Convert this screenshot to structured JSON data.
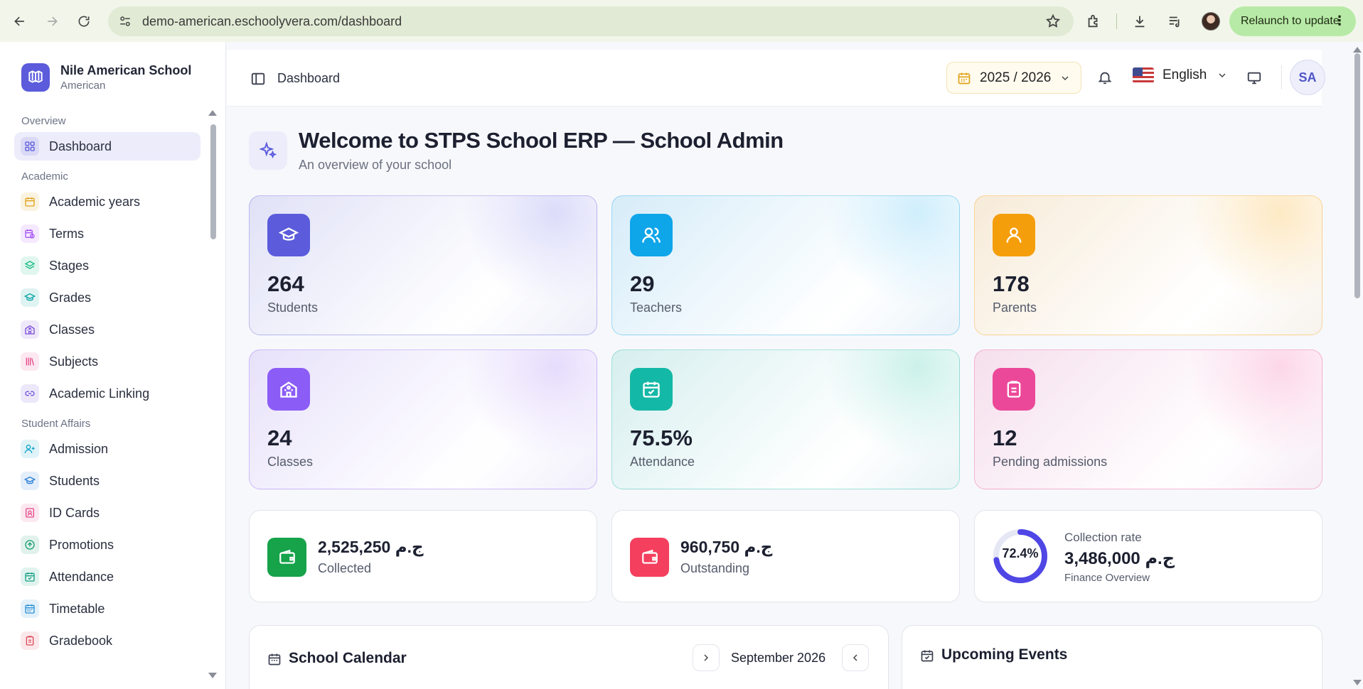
{
  "browser": {
    "url": "demo-american.eschoolyvera.com/dashboard",
    "relaunch_label": "Relaunch to update"
  },
  "school": {
    "name": "Nile American School",
    "type": "American"
  },
  "sidebar": {
    "sections": [
      {
        "label": "Overview",
        "items": [
          {
            "label": "Dashboard",
            "icon": "grid-icon",
            "color": "#5b5bdc",
            "active": true
          }
        ]
      },
      {
        "label": "Academic",
        "items": [
          {
            "label": "Academic years",
            "icon": "calendar-icon",
            "color": "#e0a21a"
          },
          {
            "label": "Terms",
            "icon": "calendar-clock-icon",
            "color": "#a855f7"
          },
          {
            "label": "Stages",
            "icon": "layers-icon",
            "color": "#10b981"
          },
          {
            "label": "Grades",
            "icon": "graduation-cap-icon",
            "color": "#0ea5a5"
          },
          {
            "label": "Classes",
            "icon": "school-icon",
            "color": "#7c4dd8"
          },
          {
            "label": "Subjects",
            "icon": "library-icon",
            "color": "#e64a8a"
          },
          {
            "label": "Academic Linking",
            "icon": "link-icon",
            "color": "#6d4fd8"
          }
        ]
      },
      {
        "label": "Student Affairs",
        "items": [
          {
            "label": "Admission",
            "icon": "user-plus-icon",
            "color": "#0ea5c9"
          },
          {
            "label": "Students",
            "icon": "graduation-cap-icon",
            "color": "#2a7fd8"
          },
          {
            "label": "ID Cards",
            "icon": "id-card-icon",
            "color": "#e64a8a"
          },
          {
            "label": "Promotions",
            "icon": "arrow-up-circle-icon",
            "color": "#1a9e70"
          },
          {
            "label": "Attendance",
            "icon": "calendar-check-icon",
            "color": "#14a085"
          },
          {
            "label": "Timetable",
            "icon": "calendar-grid-icon",
            "color": "#2a8fd8"
          },
          {
            "label": "Gradebook",
            "icon": "clipboard-icon",
            "color": "#e04a5a"
          }
        ]
      }
    ]
  },
  "topbar": {
    "breadcrumb": "Dashboard",
    "academic_year": "2025 / 2026",
    "language": "English",
    "avatar_initials": "SA"
  },
  "welcome": {
    "title": "Welcome to STPS School ERP — School Admin",
    "subtitle": "An overview of your school"
  },
  "stats": [
    {
      "value": "264",
      "label": "Students",
      "icon": "graduation-cap-icon",
      "color": "#5b5bdc",
      "tint": "#dcdcfa"
    },
    {
      "value": "29",
      "label": "Teachers",
      "icon": "users-icon",
      "color": "#0ea5e9",
      "tint": "#cfeefc"
    },
    {
      "value": "178",
      "label": "Parents",
      "icon": "user-icon",
      "color": "#f59e0b",
      "tint": "#fde9c4"
    },
    {
      "value": "24",
      "label": "Classes",
      "icon": "school-icon",
      "color": "#8b5cf6",
      "tint": "#e6dcfc"
    },
    {
      "value": "75.5%",
      "label": "Attendance",
      "icon": "calendar-check-icon",
      "color": "#14b8a6",
      "tint": "#ccf1ea"
    },
    {
      "value": "12",
      "label": "Pending admissions",
      "icon": "clipboard-icon",
      "color": "#ec4899",
      "tint": "#fcd7e8"
    }
  ],
  "finance": {
    "collected": {
      "value": "2,525,250 ج.م",
      "label": "Collected",
      "color": "#16a34a"
    },
    "outstanding": {
      "value": "960,750 ج.م",
      "label": "Outstanding",
      "color": "#f43f5e"
    },
    "rate": {
      "percent_text": "72.4%",
      "percent": 72.4,
      "label": "Collection rate",
      "value": "3,486,000 ج.م",
      "sub": "Finance Overview",
      "color": "#4f46e5"
    }
  },
  "calendar": {
    "title": "School Calendar",
    "month": "September 2026"
  },
  "events": {
    "title": "Upcoming Events"
  }
}
